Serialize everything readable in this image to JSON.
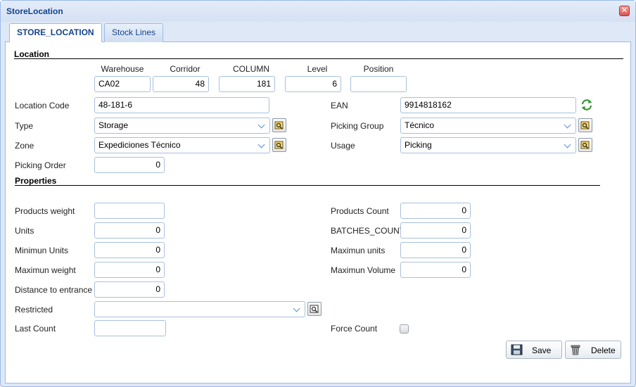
{
  "window": {
    "title": "StoreLocation"
  },
  "tabs": [
    {
      "label": "STORE_LOCATION",
      "active": true
    },
    {
      "label": "Stock Lines",
      "active": false
    }
  ],
  "location": {
    "section_title": "Location",
    "columns": {
      "warehouse": {
        "label": "Warehouse",
        "value": "CA02"
      },
      "corridor": {
        "label": "Corridor",
        "value": "48"
      },
      "column": {
        "label": "COLUMN",
        "value": "181"
      },
      "level": {
        "label": "Level",
        "value": "6"
      },
      "position": {
        "label": "Position",
        "value": ""
      }
    },
    "location_code": {
      "label": "Location Code",
      "value": "48-181-6"
    },
    "ean": {
      "label": "EAN",
      "value": "9914818162"
    },
    "type": {
      "label": "Type",
      "value": "Storage"
    },
    "picking_group": {
      "label": "Picking Group",
      "value": "Técnico"
    },
    "zone": {
      "label": "Zone",
      "value": "Expediciones Técnico"
    },
    "usage": {
      "label": "Usage",
      "value": "Picking"
    },
    "picking_order": {
      "label": "Picking Order",
      "value": "0"
    }
  },
  "properties": {
    "section_title": "Properties",
    "products_weight": {
      "label": "Products weight",
      "value": ""
    },
    "products_count": {
      "label": "Products Count",
      "value": "0"
    },
    "units": {
      "label": "Units",
      "value": "0"
    },
    "batches_count": {
      "label": "BATCHES_COUNT",
      "value": "0"
    },
    "minimun_units": {
      "label": "Minimun Units",
      "value": "0"
    },
    "maximun_units": {
      "label": "Maximun units",
      "value": "0"
    },
    "maximun_weight": {
      "label": "Maximun weight",
      "value": "0"
    },
    "maximun_volume": {
      "label": "Maximun Volume",
      "value": "0"
    },
    "distance_to_entrance": {
      "label": "Distance to entrance",
      "value": "0"
    },
    "restricted": {
      "label": "Restricted",
      "value": ""
    },
    "last_count": {
      "label": "Last Count",
      "value": ""
    },
    "force_count": {
      "label": "Force Count",
      "checked": false
    }
  },
  "actions": {
    "save_label": "Save",
    "delete_label": "Delete"
  },
  "icons": {
    "close": "close-icon",
    "refresh": "refresh-icon",
    "lookup": "lookup-icon",
    "save": "floppy-disk-icon",
    "delete": "trash-icon"
  },
  "colors": {
    "title_text": "#15428b",
    "border": "#99bbe8",
    "window_bg": "#dfe8f6",
    "refresh_green": "#2e9a2e"
  }
}
